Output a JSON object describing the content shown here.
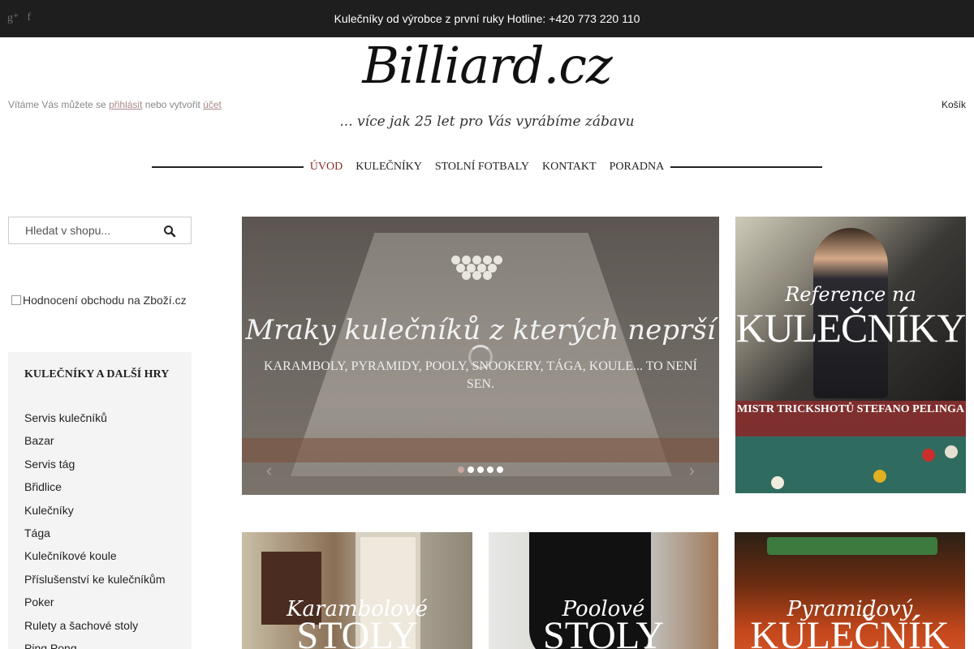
{
  "topbar": {
    "hotline": "Kulečníky od výrobce z první ruky Hotline: +420 773 220 110",
    "social": [
      {
        "icon": "google-plus-icon",
        "glyph": "g⁺"
      },
      {
        "icon": "facebook-icon",
        "glyph": "f"
      }
    ]
  },
  "header": {
    "logo": "Billiard.cz",
    "tagline": "... více jak 25 let pro Vás vyrábíme zábavu",
    "welcome_prefix": "Vítáme Vás můžete se",
    "login_link": "přihlásit",
    "welcome_middle": "nebo vytvořit",
    "account_link": "účet",
    "cart": "Košík"
  },
  "nav": {
    "items": [
      {
        "label": "ÚVOD",
        "active": true
      },
      {
        "label": "KULEČNÍKY",
        "active": false
      },
      {
        "label": "STOLNÍ FOTBALY",
        "active": false
      },
      {
        "label": "KONTAKT",
        "active": false
      },
      {
        "label": "PORADNA",
        "active": false
      }
    ]
  },
  "search": {
    "placeholder": "Hledat v shopu...",
    "icon": "search-icon"
  },
  "rating": {
    "alt_text": "Hodnocení obchodu na Zboží.cz"
  },
  "sidebar": {
    "title": "KULEČNÍKY A DALŠÍ HRY",
    "items": [
      "Servis kulečníků",
      "Bazar",
      "Servis tág",
      "Břidlice",
      "Kulečníky",
      "Tága",
      "Kulečníkové koule",
      "Příslušenství ke kulečníkům",
      "Poker",
      "Rulety a šachové stoly",
      "Ping Pong"
    ]
  },
  "slider": {
    "headline": "Mraky kulečníků z kterých neprší",
    "subtext": "KARAMBOLY, PYRAMIDY, POOLY, SNOOKERY, TÁGA, KOULE... TO NENÍ SEN.",
    "slide_count": 5,
    "active_slide": 1
  },
  "reference": {
    "small": "Reference na",
    "big": "KULEČNÍKY",
    "band": "MISTR TRICKSHOTŮ STEFANO PELINGA"
  },
  "tiles": [
    {
      "small": "Karambolové",
      "big": "STOLY"
    },
    {
      "small": "Poolové",
      "big": "STOLY"
    },
    {
      "small": "Pyramidový",
      "big": "KULEČNÍK"
    }
  ],
  "colors": {
    "topbar_bg": "#1e1e1e",
    "nav_active": "#8b2c2c",
    "sidebar_bg": "#f4f4f4",
    "band_bg": "#8b2c2c"
  }
}
